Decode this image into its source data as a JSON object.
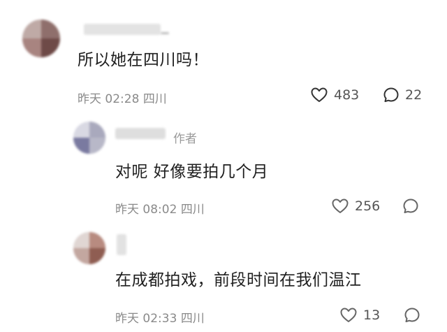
{
  "comments": [
    {
      "author_tag": "",
      "text": "所以她在四川吗！",
      "time": "昨天 02:28",
      "location": "四川",
      "likes": "483",
      "replies": "22"
    },
    {
      "author_tag": "作者",
      "text": "对呢 好像要拍几个月",
      "time": "昨天 08:02",
      "location": "四川",
      "likes": "256",
      "replies": ""
    },
    {
      "author_tag": "",
      "text": "在成都拍戏，前段时间在我们温江",
      "time": "昨天 02:33",
      "location": "四川",
      "likes": "13",
      "replies": ""
    }
  ],
  "icons": {
    "like": "heart-outline-icon",
    "reply": "speech-bubble-icon"
  },
  "colors": {
    "meta": "#8a8a8a",
    "text": "#1f1f1f",
    "icon": "#555555"
  }
}
